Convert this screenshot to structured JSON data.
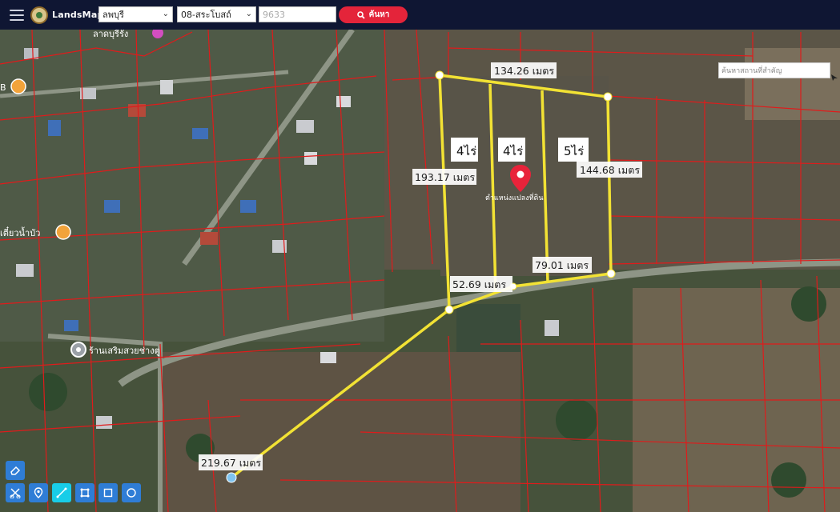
{
  "app": {
    "brand": "LandsMaps"
  },
  "search": {
    "province": "ลพบุรี",
    "district": "08-สระโบสถ์",
    "parcel_number": "9633",
    "search_button": "ค้นหา"
  },
  "poi_search": {
    "placeholder": "ค้นหาสถานที่สำคัญ"
  },
  "measurements": {
    "top_edge": "134.26 เมตร",
    "left_edge": "193.17 เมตร",
    "right_edge": "144.68 เมตร",
    "bottom_right": "79.01 เมตร",
    "bottom_left": "52.69 เมตร",
    "distance_line": "219.67 เมตร"
  },
  "areas": {
    "plot_1": "4ไร่",
    "plot_2": "4ไร่",
    "plot_3": "5ไร่"
  },
  "marker": {
    "label": "ตำแหน่งแปลงที่ดิน"
  },
  "places": {
    "shop_1": "ร้านเสริมสวยช่างตู",
    "shop_2": "เตี๋ยวน้ำบัว",
    "top_place": "ลาดบุรีรัง"
  },
  "colors": {
    "topbar": "#0f1633",
    "search_button": "#e4243a",
    "measure_line": "#f2e234",
    "parcel_lines": "#e01b1b",
    "marker": "#e8233a",
    "tool": "#2f7dd6",
    "tool_active": "#18cde8"
  },
  "tools": {
    "row1": [
      "eraser-icon"
    ],
    "row2": [
      "cut-icon",
      "pin-icon",
      "line-icon",
      "shape-icon",
      "rectangle-icon",
      "circle-icon"
    ],
    "active": "line-icon"
  }
}
